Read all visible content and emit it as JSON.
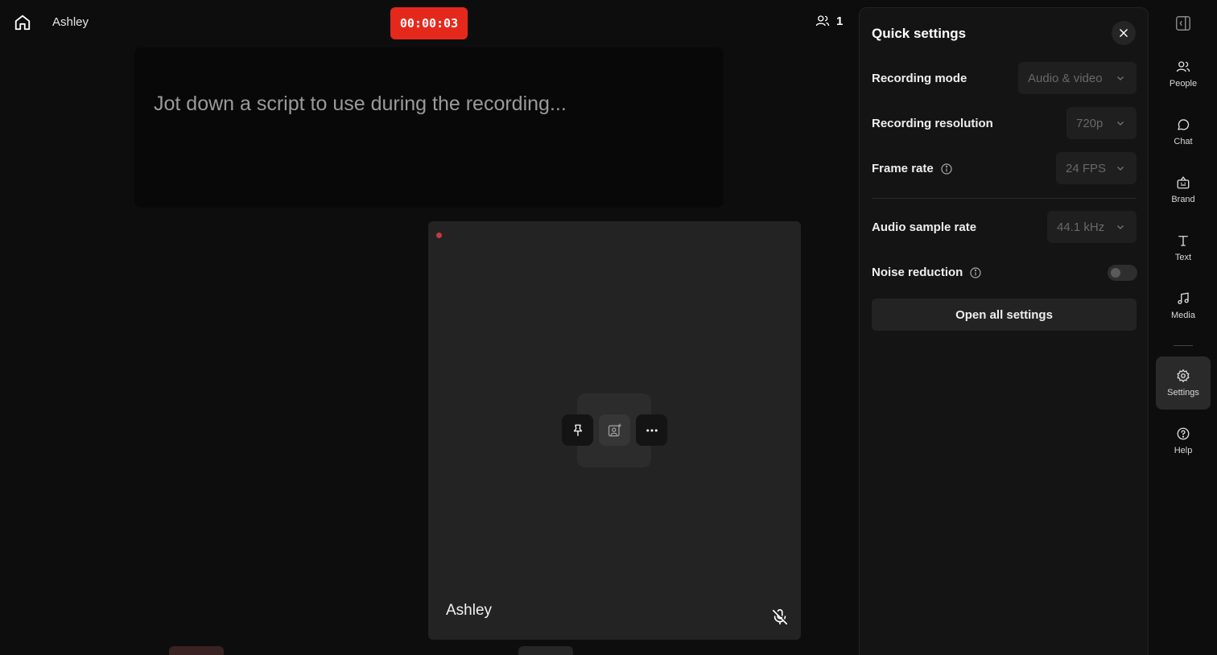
{
  "header": {
    "studio_name": "Ashley",
    "timer": "00:00:03",
    "participant_count": "1"
  },
  "script": {
    "placeholder": "Jot down a script to use during the recording..."
  },
  "tile": {
    "name": "Ashley"
  },
  "quick_settings": {
    "title": "Quick settings",
    "rows": {
      "recording_mode": {
        "label": "Recording mode",
        "value": "Audio & video"
      },
      "recording_resolution": {
        "label": "Recording resolution",
        "value": "720p"
      },
      "frame_rate": {
        "label": "Frame rate",
        "value": "24 FPS"
      },
      "audio_sample_rate": {
        "label": "Audio sample rate",
        "value": "44.1 kHz"
      },
      "noise_reduction": {
        "label": "Noise reduction",
        "enabled": false
      }
    },
    "open_all_label": "Open all settings"
  },
  "rail": {
    "items": [
      {
        "label": "People",
        "icon": "people-icon"
      },
      {
        "label": "Chat",
        "icon": "chat-icon"
      },
      {
        "label": "Brand",
        "icon": "brand-icon"
      },
      {
        "label": "Text",
        "icon": "text-icon"
      },
      {
        "label": "Media",
        "icon": "music-note-icon"
      },
      {
        "label": "Settings",
        "icon": "gear-icon",
        "active": true
      },
      {
        "label": "Help",
        "icon": "help-icon"
      }
    ]
  },
  "colors": {
    "background": "#0d0d0d",
    "timer": "#e5281c",
    "panel": "#141414"
  }
}
